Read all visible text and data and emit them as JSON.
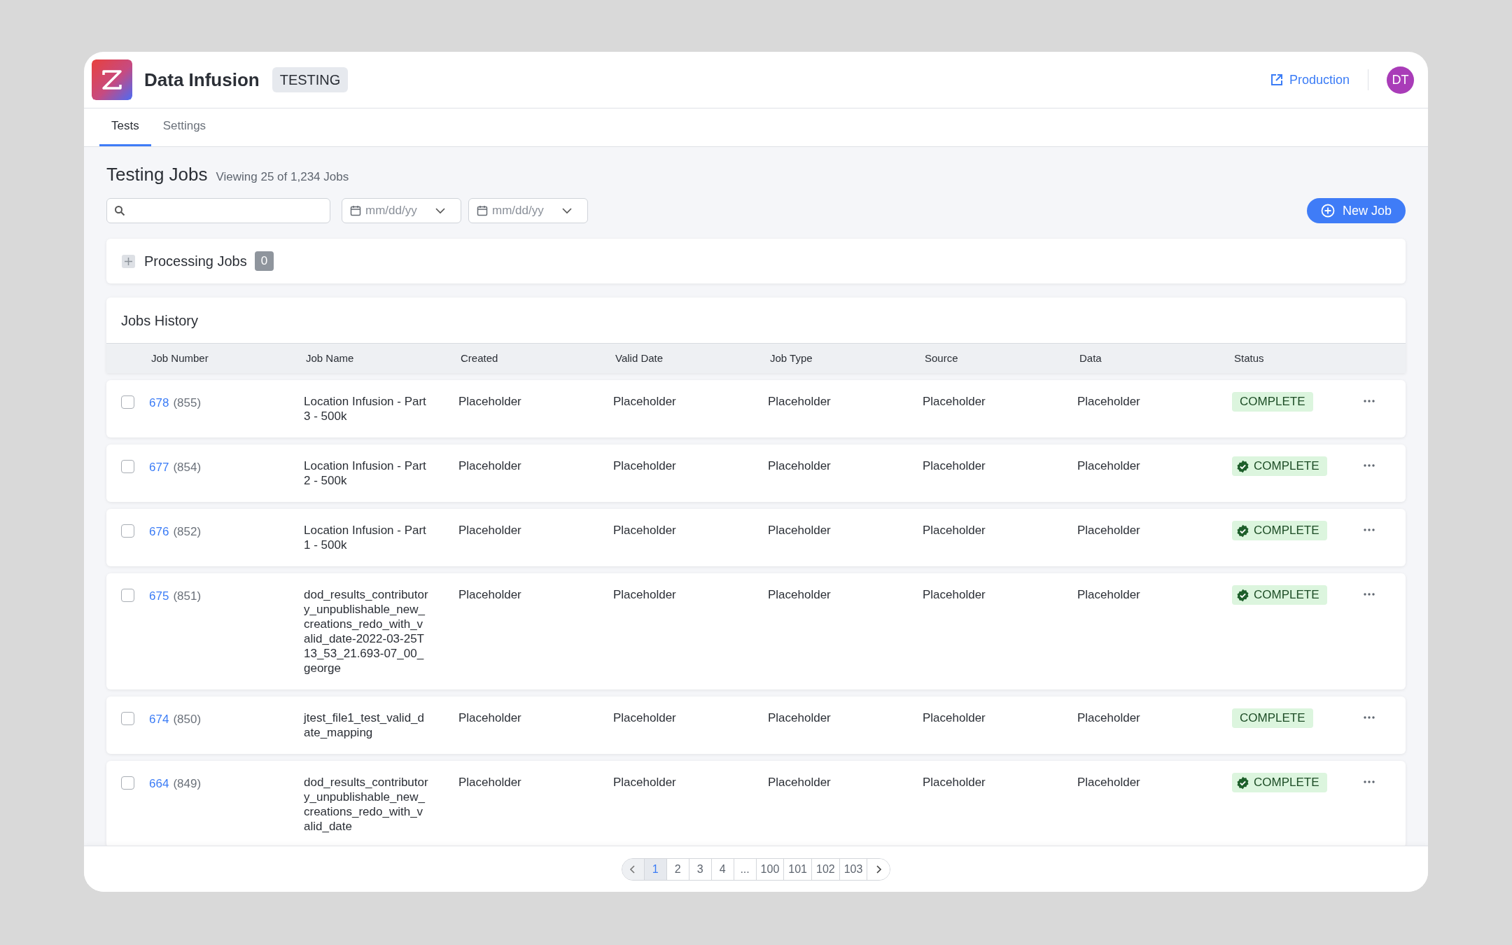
{
  "app": {
    "title": "Data Infusion",
    "env_badge": "TESTING",
    "production_link": "Production",
    "avatar": "DT"
  },
  "tabs": [
    {
      "label": "Tests",
      "selected": true
    },
    {
      "label": "Settings",
      "selected": false
    }
  ],
  "page": {
    "title": "Testing Jobs",
    "subtitle": "Viewing 25 of 1,234 Jobs"
  },
  "filters": {
    "date_from": {
      "placeholder": "mm/dd/yy"
    },
    "date_to": {
      "placeholder": "mm/dd/yy"
    },
    "new_button": "New Job"
  },
  "processing": {
    "title": "Processing Jobs",
    "count": "0"
  },
  "history": {
    "title": "Jobs History",
    "columns": [
      "Job Number",
      "Job Name",
      "Created",
      "Valid Date",
      "Job Type",
      "Source",
      "Data",
      "Status"
    ],
    "rows": [
      {
        "checked": false,
        "number": "678",
        "sub": "(855)",
        "name": "Location Infusion - Part 3 - 500k",
        "created": "Placeholder",
        "valid_date": "Placeholder",
        "job_type": "Placeholder",
        "source": "Placeholder",
        "data": "Placeholder",
        "status": "COMPLETE",
        "verified": false
      },
      {
        "checked": false,
        "number": "677",
        "sub": "(854)",
        "name": "Location Infusion - Part 2 - 500k",
        "created": "Placeholder",
        "valid_date": "Placeholder",
        "job_type": "Placeholder",
        "source": "Placeholder",
        "data": "Placeholder",
        "status": "COMPLETE",
        "verified": true
      },
      {
        "checked": false,
        "number": "676",
        "sub": "(852)",
        "name": "Location Infusion - Part 1 - 500k",
        "created": "Placeholder",
        "valid_date": "Placeholder",
        "job_type": "Placeholder",
        "source": "Placeholder",
        "data": "Placeholder",
        "status": "COMPLETE",
        "verified": true
      },
      {
        "checked": false,
        "number": "675",
        "sub": "(851)",
        "name": "dod_results_contributory_unpublishable_new_creations_redo_with_valid_date-2022-03-25T13_53_21.693-07_00_george",
        "created": "Placeholder",
        "valid_date": "Placeholder",
        "job_type": "Placeholder",
        "source": "Placeholder",
        "data": "Placeholder",
        "status": "COMPLETE",
        "verified": true
      },
      {
        "checked": false,
        "number": "674",
        "sub": "(850)",
        "name": "jtest_file1_test_valid_date_mapping",
        "created": "Placeholder",
        "valid_date": "Placeholder",
        "job_type": "Placeholder",
        "source": "Placeholder",
        "data": "Placeholder",
        "status": "COMPLETE",
        "verified": false
      },
      {
        "checked": false,
        "number": "664",
        "sub": "(849)",
        "name": "dod_results_contributory_unpublishable_new_creations_redo_with_valid_date",
        "created": "Placeholder",
        "valid_date": "Placeholder",
        "job_type": "Placeholder",
        "source": "Placeholder",
        "data": "Placeholder",
        "status": "COMPLETE",
        "verified": true
      }
    ]
  },
  "pagination": [
    {
      "label": "1",
      "selected": true
    },
    {
      "label": "2",
      "selected": false
    },
    {
      "label": "3",
      "selected": false
    },
    {
      "label": "4",
      "selected": false
    },
    {
      "label": "...",
      "selected": false
    },
    {
      "label": "100",
      "selected": false
    },
    {
      "label": "101",
      "selected": false
    },
    {
      "label": "102",
      "selected": false
    },
    {
      "label": "103",
      "selected": false
    }
  ]
}
